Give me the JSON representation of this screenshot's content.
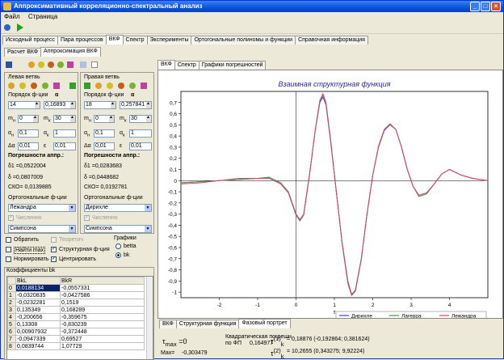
{
  "app": {
    "title": "Аппроксимативный корреляционно-спектральный анализ"
  },
  "menu": [
    "Файл",
    "Страница"
  ],
  "main_tabs": [
    "Исходный процесс",
    "Пара процессов",
    "ВКФ",
    "Спектр",
    "Эксперименты",
    "Ортогональные полиномы и функции",
    "Справочная информация"
  ],
  "sub_tabs": [
    "Расчет ВКФ",
    "Аппроксимация ВКФ"
  ],
  "right_tabs": [
    "ВКФ",
    "Спектр",
    "Графики погрешностей"
  ],
  "left": {
    "title": "Левая ветвь",
    "order_label": "Порядок ф-ции",
    "alpha_label": "α",
    "order": "14",
    "alpha": "0,16893",
    "mh_label": "m",
    "mh_sub": "н",
    "mh": "0",
    "mk_label": "m",
    "mk_sub": "к",
    "mk": "30",
    "ah_label": "α",
    "ah_sub": "н",
    "ah": "0,1",
    "ak_label": "α",
    "ak_sub": "к",
    "ak": "1",
    "da_label": "Δα",
    "da": "0,01",
    "eps_label": "ε",
    "eps": "0,01",
    "err_title": "Погрешности аппр.:",
    "d1": "δ1 =0,0522004",
    "d": "δ =0,0807009",
    "cko": "СКО= 0,0139885",
    "orth_label": "Ортогональные ф-ции",
    "func": "Лежандра",
    "num_label": "Численно",
    "method": "Симпсона"
  },
  "right": {
    "title": "Правая ветвь",
    "order_label": "Порядок ф-ции",
    "alpha_label": "α",
    "order": "18",
    "alpha": "0,257841",
    "mh_label": "m",
    "mh_sub": "н",
    "mh": "0",
    "mk_label": "m",
    "mk_sub": "к",
    "mk": "30",
    "ah_label": "α",
    "ah_sub": "н",
    "ah": "0,1",
    "ak_label": "α",
    "ak_sub": "к",
    "ak": "1",
    "da_label": "Δα",
    "da": "0,01",
    "eps_label": "ε",
    "eps": "0,01",
    "err_title": "Погрешности аппр.:",
    "d1": "δ1 =0,0283683",
    "d": "δ =0,0448682",
    "cko": "СКО= 0,0192781",
    "orth_label": "Ортогональные ф-ции",
    "func": "Дирихле",
    "num_label": "Численно",
    "method": "Симпсона"
  },
  "options": {
    "invert": "Обратить",
    "theoretic": "Теоретич",
    "find_max": "Найти max",
    "struct": "Структурная ф-ция",
    "normalize": "Нормировать",
    "center": "Центрировать",
    "graphs": "Графики",
    "betta": "betta",
    "bk": "bk"
  },
  "coef": {
    "title": "Коэффициенты bk",
    "headers": [
      "",
      "BkL",
      "BkR"
    ],
    "rows": [
      [
        "0",
        "0,0188134",
        "-0,0557331"
      ],
      [
        "1",
        "-0,0320835",
        "-0,0427586"
      ],
      [
        "2",
        "-0,0232281",
        "0,1519"
      ],
      [
        "3",
        "0,135349",
        "0,168289"
      ],
      [
        "4",
        "-0,200656",
        "-0,359675"
      ],
      [
        "5",
        "0,13308",
        "-0,830239"
      ],
      [
        "6",
        "0,00907932",
        "-0,372448"
      ],
      [
        "7",
        "-0,0947339",
        "0,69527"
      ],
      [
        "8",
        "0,0839744",
        "1,07729"
      ]
    ]
  },
  "bottom_tabs": [
    "ВКФ",
    "Структурная функция",
    "Фазовый портрет"
  ],
  "bottom": {
    "tau_label": "τ",
    "tau_sub": "max",
    "tau_val": "=0",
    "max_label": "Max=",
    "max_val": "-0,303479",
    "sq_err_label": "Квадратическая погрешн.",
    "by_fp": "по ФП",
    "sq_err_val": "0,164977",
    "tk1_label": "τ",
    "tk1_sub": "k",
    "tk1_sup": "(1)",
    "tk1_val": "= 0,18876 (-0,192864; 0,381624)",
    "tk2_label": "τ",
    "tk2_sub": "k",
    "tk2_sup": "(2)",
    "tk2_val": "= 10,2655 (0,343275; 9,92224)"
  },
  "chart_data": {
    "type": "line",
    "title": "Взаимная структурная функция",
    "xlabel": "τ",
    "ylabel": "",
    "xlim": [
      -3,
      5
    ],
    "ylim": [
      -1.05,
      0.8
    ],
    "xticks": [
      -2,
      -1,
      0,
      1,
      2,
      3,
      4
    ],
    "yticks": [
      0.7,
      0.6,
      0.5,
      0.4,
      0.3,
      0.2,
      0.1,
      0,
      -0.1,
      -0.2,
      -0.3,
      -0.4,
      -0.5,
      -0.6,
      -0.7,
      -0.8,
      -0.9,
      -1
    ],
    "legend_position": "bottom-right",
    "series": [
      {
        "name": "Дирихле",
        "color": "#4040ff",
        "x": [
          -3,
          -2.5,
          -2,
          -1.5,
          -1,
          -0.7,
          -0.4,
          -0.2,
          0,
          0.1,
          0.2,
          0.35,
          0.5,
          0.62,
          0.7,
          0.78,
          0.9,
          1.05,
          1.2,
          1.35,
          1.45,
          1.55,
          1.7,
          1.85,
          2,
          2.15,
          2.3,
          2.45,
          2.6,
          2.75,
          2.9,
          3.05,
          3.2,
          3.4,
          3.6,
          3.8,
          4,
          4.3,
          4.6,
          5
        ],
        "y": [
          -0.02,
          -0.01,
          0,
          0.01,
          0.02,
          0.03,
          -0.02,
          -0.1,
          -0.3,
          -0.35,
          -0.3,
          0.05,
          0.45,
          0.7,
          0.75,
          0.68,
          0.35,
          -0.1,
          -0.55,
          -0.9,
          -1.02,
          -0.98,
          -0.7,
          -0.3,
          0.05,
          0.3,
          0.45,
          0.5,
          0.46,
          0.3,
          0.1,
          -0.05,
          -0.14,
          -0.12,
          -0.03,
          0.06,
          0.1,
          0.05,
          0.02,
          0
        ]
      },
      {
        "name": "Лагерра",
        "color": "#40a040",
        "x": [
          -3,
          -2.5,
          -2,
          -1.5,
          -1,
          -0.7,
          -0.4,
          -0.2,
          0,
          0.1,
          0.2,
          0.35,
          0.5,
          0.62,
          0.7,
          0.78,
          0.9,
          1.05,
          1.2,
          1.35,
          1.45,
          1.55,
          1.7,
          1.85,
          2,
          2.15,
          2.3,
          2.45,
          2.6,
          2.75,
          2.9,
          3.05,
          3.2,
          3.4,
          3.6,
          3.8,
          4,
          4.3,
          4.6,
          5
        ],
        "y": [
          -0.02,
          -0.01,
          0,
          0.01,
          0.02,
          0.03,
          -0.02,
          -0.1,
          -0.3,
          -0.36,
          -0.3,
          0.05,
          0.45,
          0.71,
          0.77,
          0.69,
          0.36,
          -0.1,
          -0.55,
          -0.9,
          -1.03,
          -0.98,
          -0.7,
          -0.3,
          0.05,
          0.3,
          0.46,
          0.5,
          0.46,
          0.3,
          0.1,
          -0.05,
          -0.14,
          -0.12,
          -0.03,
          0.06,
          0.1,
          0.05,
          0.02,
          0
        ]
      },
      {
        "name": "Лежандра",
        "color": "#e0406a",
        "x": [
          -3,
          -2.5,
          -2,
          -1.5,
          -1,
          -0.7,
          -0.4,
          -0.2,
          0,
          0.1,
          0.2,
          0.35,
          0.5,
          0.62,
          0.7,
          0.78,
          0.9,
          1.05,
          1.2,
          1.35,
          1.45,
          1.55,
          1.7,
          1.85,
          2,
          2.15,
          2.3,
          2.45,
          2.6,
          2.75,
          2.9,
          3.05,
          3.2,
          3.4,
          3.6,
          3.8,
          4,
          4.3,
          4.6,
          5
        ],
        "y": [
          -0.03,
          -0.02,
          0,
          0.02,
          0.02,
          0.02,
          -0.03,
          -0.11,
          -0.31,
          -0.36,
          -0.31,
          0.04,
          0.46,
          0.72,
          0.78,
          0.7,
          0.37,
          -0.1,
          -0.56,
          -0.92,
          -1.03,
          -0.99,
          -0.71,
          -0.3,
          0.05,
          0.31,
          0.46,
          0.51,
          0.46,
          0.3,
          0.1,
          -0.05,
          -0.13,
          -0.11,
          -0.03,
          0.06,
          0.1,
          0.05,
          0.02,
          0
        ]
      }
    ]
  }
}
